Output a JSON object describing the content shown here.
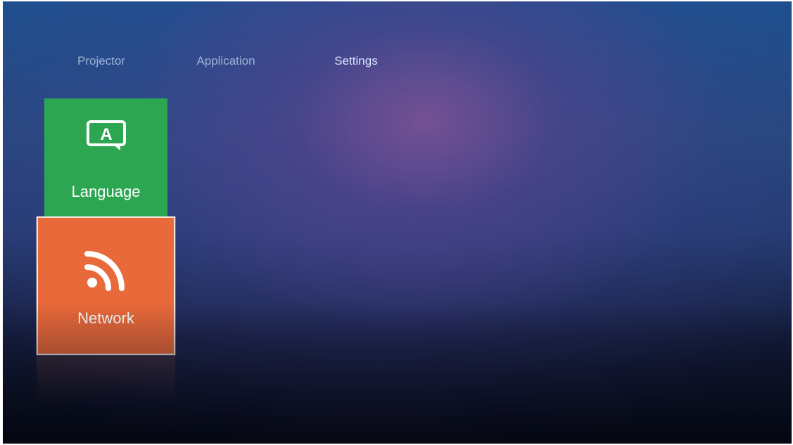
{
  "nav": {
    "tabs": [
      {
        "label": "Projector",
        "selected": false
      },
      {
        "label": "Application",
        "selected": false
      },
      {
        "label": "Settings",
        "selected": true
      }
    ]
  },
  "tiles": [
    {
      "label": "Language",
      "icon": "language-icon",
      "color": "#2da651",
      "focused": false
    },
    {
      "label": "Network",
      "icon": "wifi-icon",
      "color": "#e8693a",
      "focused": true
    }
  ],
  "icons": {
    "language_glyph": "A"
  },
  "colors": {
    "accent_tab": "#3f7fe0",
    "tab_text": "#9fb3d6",
    "background_top": "#1e4f8e",
    "background_bottom": "#090d1c"
  }
}
